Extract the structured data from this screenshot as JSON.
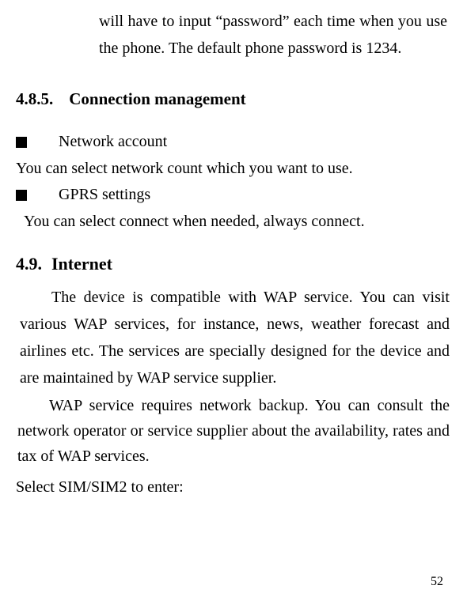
{
  "intro": "will have to input “password” each time when you use the phone. The default phone password is 1234.",
  "section485": {
    "number": "4.8.5.",
    "title": "Connection management"
  },
  "bullets": {
    "network": {
      "label": "Network account",
      "desc": "You can select network count which you want to use."
    },
    "gprs": {
      "label": "GPRS settings",
      "desc": "You can select connect when needed, always connect."
    }
  },
  "section49": {
    "number": "4.9.",
    "title": "Internet"
  },
  "internet_para1": "The device is compatible with WAP service. You can visit various WAP services, for instance, news, weather forecast and airlines etc. The services are specially designed for the device and are maintained by WAP service supplier.",
  "internet_para2": "WAP service requires network backup. You can consult the network operator or service supplier about the availability, rates and tax of WAP services.",
  "select_sim": "Select SIM/SIM2 to enter:",
  "page_number": "52"
}
